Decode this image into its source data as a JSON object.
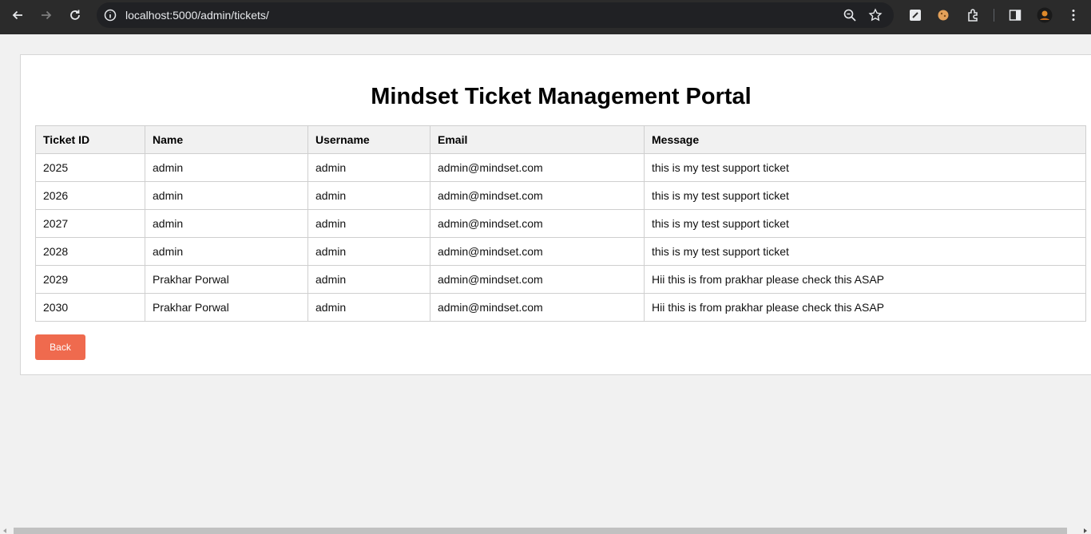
{
  "browser": {
    "url": "localhost:5000/admin/tickets/",
    "icons": [
      "back-arrow-icon",
      "forward-arrow-icon",
      "reload-icon",
      "site-info-icon",
      "zoom-icon",
      "bookmark-star-icon",
      "extension-icon",
      "cookie-extension-icon",
      "puzzle-extensions-icon",
      "side-panel-icon",
      "profile-avatar",
      "menu-dots-icon"
    ]
  },
  "page": {
    "title": "Mindset Ticket Management Portal",
    "back_label": "Back"
  },
  "table": {
    "headers": [
      "Ticket ID",
      "Name",
      "Username",
      "Email",
      "Message"
    ],
    "rows": [
      [
        "2025",
        "admin",
        "admin",
        "admin@mindset.com",
        "this is my test support ticket"
      ],
      [
        "2026",
        "admin",
        "admin",
        "admin@mindset.com",
        "this is my test support ticket"
      ],
      [
        "2027",
        "admin",
        "admin",
        "admin@mindset.com",
        "this is my test support ticket"
      ],
      [
        "2028",
        "admin",
        "admin",
        "admin@mindset.com",
        "this is my test support ticket"
      ],
      [
        "2029",
        "Prakhar Porwal",
        "admin",
        "admin@mindset.com",
        "Hii this is from prakhar please check this ASAP"
      ],
      [
        "2030",
        "Prakhar Porwal",
        "admin",
        "admin@mindset.com",
        "Hii this is from prakhar please check this ASAP"
      ]
    ]
  },
  "colors": {
    "accent": "#ef6a4e",
    "chrome_bg": "#2b2b2b",
    "page_bg": "#f1f1f1"
  }
}
